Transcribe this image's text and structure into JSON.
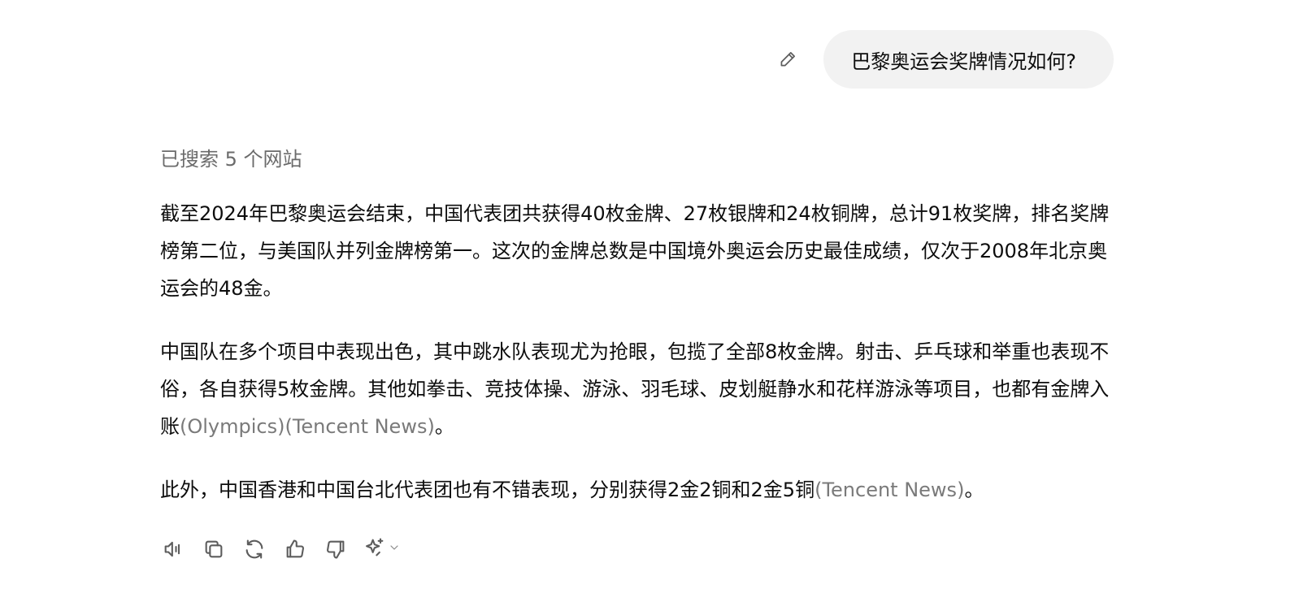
{
  "user_message": {
    "text": "巴黎奥运会奖牌情况如何?"
  },
  "assistant": {
    "search_status": "已搜索 5 个网站",
    "paragraphs": [
      {
        "text": "截至2024年巴黎奥运会结束，中国代表团共获得40枚金牌、27枚银牌和24枚铜牌，总计91枚奖牌，排名奖牌榜第二位，与美国队并列金牌榜第一。这次的金牌总数是中国境外奥运会历史最佳成绩，仅次于2008年北京奥运会的48金。"
      },
      {
        "text": "中国队在多个项目中表现出色，其中跳水队表现尤为抢眼，包揽了全部8枚金牌。射击、乒乓球和举重也表现不俗，各自获得5枚金牌。其他如拳击、竞技体操、游泳、羽毛球、皮划艇静水和花样游泳等项目，也都有金牌入账",
        "citations": [
          "(Olympics)",
          "(Tencent News)"
        ],
        "tail": "。"
      },
      {
        "text": "此外，中国香港和中国台北代表团也有不错表现，分别获得2金2铜和2金5铜",
        "citations": [
          "(Tencent News)"
        ],
        "tail": "。"
      }
    ]
  },
  "actions": {
    "icons": [
      "speaker-icon",
      "copy-icon",
      "regenerate-icon",
      "thumbs-up-icon",
      "thumbs-down-icon",
      "sparkle-icon",
      "chevron-down-icon"
    ]
  },
  "colors": {
    "bubble_bg": "#f2f2f2",
    "text": "#0d0d0d",
    "muted": "#6b6b6b",
    "citation": "#7a7a7a",
    "icon": "#5d5d5d"
  }
}
